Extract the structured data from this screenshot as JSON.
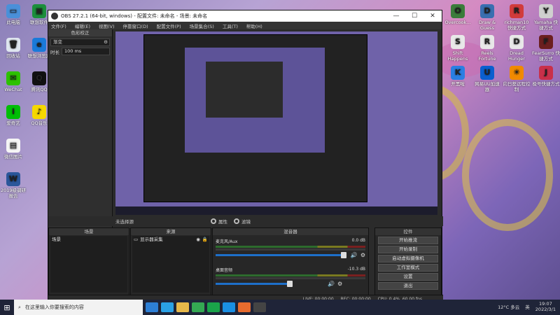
{
  "window": {
    "title": "OBS 27.2.1 (64-bit, windows) - 配置文件: 未命名 - 场景: 未命名",
    "minimize": "—",
    "maximize": "☐",
    "close": "✕"
  },
  "menu": [
    "文件(F)",
    "编辑(E)",
    "视图(V)",
    "停靠窗口(D)",
    "配置文件(P)",
    "场景集合(S)",
    "工具(T)",
    "帮助(H)"
  ],
  "filters": {
    "header": "色彩校正",
    "type_value": "渐变",
    "time_label": "时长",
    "time_value": "100 ms"
  },
  "transition": {
    "label": "未选择源",
    "props_label": "属性",
    "filters_label": "滤镜"
  },
  "scenes": {
    "header": "场景",
    "items": [
      "场景"
    ]
  },
  "sources": {
    "header": "来源",
    "items": [
      "显示器采集"
    ]
  },
  "mixer": {
    "header": "混音器",
    "tracks": [
      {
        "name": "麦克风/Aux",
        "db": "0.0 dB"
      },
      {
        "name": "桌面音频",
        "db": "-10.3 dB"
      }
    ]
  },
  "controls": {
    "header": "控件",
    "buttons": [
      "开始推流",
      "开始录制",
      "启动虚拟摄像机",
      "工作室模式",
      "设置",
      "退出"
    ]
  },
  "status": {
    "live": "LIVE: 00:00:00",
    "rec": "REC: 00:00:00",
    "cpu": "CPU: 0.4%, 60.00 fps"
  },
  "desktop_icons_left": [
    {
      "label": "此电脑",
      "color": "#4a90d9",
      "glyph": "▭"
    },
    {
      "label": "回收站",
      "color": "#dfe6ef",
      "glyph": "🗑"
    },
    {
      "label": "WeChat",
      "color": "#2dc100",
      "glyph": "✉"
    },
    {
      "label": "爱奇艺",
      "color": "#00be06",
      "glyph": "i"
    },
    {
      "label": "微信图片",
      "color": "#f5f5f5",
      "glyph": "▤"
    },
    {
      "label": "2019级调研报告",
      "color": "#2b579a",
      "glyph": "W"
    }
  ],
  "desktop_icons_left2": [
    {
      "label": "联想软件",
      "color": "#1b8f3c",
      "glyph": "▣"
    },
    {
      "label": "联想浏览器",
      "color": "#1a7ad9",
      "glyph": "e"
    },
    {
      "label": "腾讯QQ",
      "color": "#111",
      "glyph": "Q"
    },
    {
      "label": "QQ音乐",
      "color": "#f5d800",
      "glyph": "♪"
    }
  ],
  "desktop_icons_right": [
    {
      "label": "Overcook...",
      "color": "#3b7c3b",
      "glyph": "O"
    },
    {
      "label": "Draw & Guess",
      "color": "#3a6fb0",
      "glyph": "D"
    },
    {
      "label": "richman10 快捷方式",
      "color": "#d13b3b",
      "glyph": "R"
    },
    {
      "label": "Yamaha 快捷方式",
      "color": "#cfcfcf",
      "glyph": "Y"
    },
    {
      "label": "Shift Happens",
      "color": "#e8e8e8",
      "glyph": "S"
    },
    {
      "label": "Reels Fortune",
      "color": "#e8e8e8",
      "glyph": "R"
    },
    {
      "label": "Dread Hunger",
      "color": "#e8e8e8",
      "glyph": "D"
    },
    {
      "label": "FearSurro 快捷方式",
      "color": "#6b1f1f",
      "glyph": "F"
    },
    {
      "label": "开黑啦",
      "color": "#2a7fe3",
      "glyph": "K"
    },
    {
      "label": "网易UU加速器",
      "color": "#0b5fcf",
      "glyph": "U"
    },
    {
      "label": "向日葵远程控制",
      "color": "#f08a00",
      "glyph": "☀"
    },
    {
      "label": "极号快捷方式",
      "color": "#c9304a",
      "glyph": "J"
    }
  ],
  "taskbar": {
    "start": "⊞",
    "search_placeholder": "在这里输入你要搜索的内容",
    "weather": "12°C 多云",
    "lang": "英",
    "time": "19:07",
    "date": "2022/3/1"
  }
}
